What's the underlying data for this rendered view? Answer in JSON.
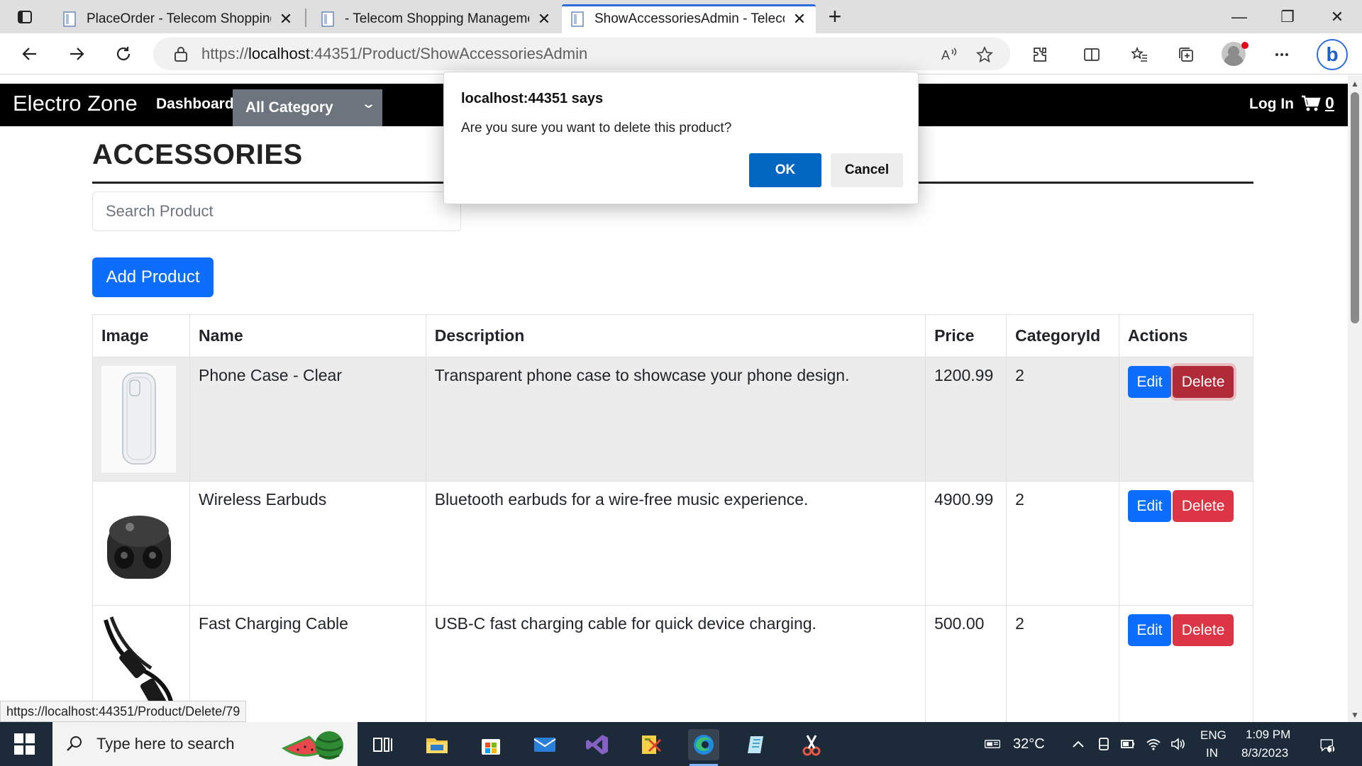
{
  "browser": {
    "tabs": [
      {
        "title": "PlaceOrder - Telecom Shopping M"
      },
      {
        "title": "- Telecom Shopping Managemen"
      },
      {
        "title": "ShowAccessoriesAdmin - Telecom"
      }
    ],
    "url_prefix": "https://",
    "url_host": "localhost",
    "url_rest": ":44351/Product/ShowAccessoriesAdmin",
    "status_url": "https://localhost:44351/Product/Delete/79"
  },
  "site": {
    "brand": "Electro Zone",
    "nav_dashboard": "Dashboard",
    "category_select": "All Category",
    "login": "Log In",
    "cart_count": "0"
  },
  "page": {
    "title": "ACCESSORIES",
    "search_placeholder": "Search Product",
    "add_button": "Add Product"
  },
  "table": {
    "headers": [
      "Image",
      "Name",
      "Description",
      "Price",
      "CategoryId",
      "Actions"
    ],
    "edit_label": "Edit",
    "delete_label": "Delete",
    "rows": [
      {
        "name": "Phone Case - Clear",
        "description": "Transparent phone case to showcase your phone design.",
        "price": "1200.99",
        "category_id": "2"
      },
      {
        "name": "Wireless Earbuds",
        "description": "Bluetooth earbuds for a wire-free music experience.",
        "price": "4900.99",
        "category_id": "2"
      },
      {
        "name": "Fast Charging Cable",
        "description": "USB-C fast charging cable for quick device charging.",
        "price": "500.00",
        "category_id": "2"
      }
    ]
  },
  "dialog": {
    "title": "localhost:44351 says",
    "message": "Are you sure you want to delete this product?",
    "ok": "OK",
    "cancel": "Cancel"
  },
  "taskbar": {
    "search_placeholder": "Type here to search",
    "temperature": "32°C",
    "lang_line1": "ENG",
    "lang_line2": "IN",
    "time": "1:09 PM",
    "date": "8/3/2023",
    "notification_count": "1"
  },
  "colors": {
    "primary": "#0d6efd",
    "danger": "#dc3545",
    "dialog_ok": "#0067c0",
    "navbar": "#000000",
    "select_bg": "#6c757d"
  }
}
